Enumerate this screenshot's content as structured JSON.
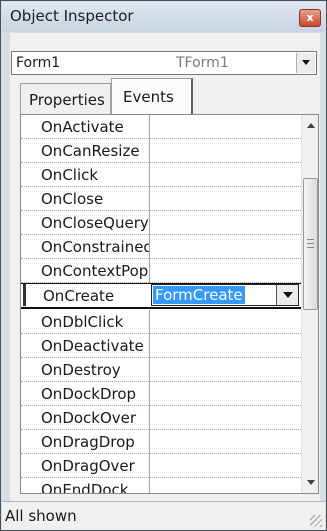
{
  "window": {
    "title": "Object Inspector",
    "close_glyph": "x"
  },
  "object_selector": {
    "name": "Form1",
    "class": "TForm1"
  },
  "tabs": [
    {
      "label": "Properties",
      "active": false
    },
    {
      "label": "Events",
      "active": true
    }
  ],
  "events": [
    {
      "name": "OnActivate",
      "value": ""
    },
    {
      "name": "OnCanResize",
      "value": ""
    },
    {
      "name": "OnClick",
      "value": ""
    },
    {
      "name": "OnClose",
      "value": ""
    },
    {
      "name": "OnCloseQuery",
      "value": ""
    },
    {
      "name": "OnConstrainedResize",
      "value": ""
    },
    {
      "name": "OnContextPopup",
      "value": ""
    },
    {
      "name": "OnCreate",
      "value": "FormCreate"
    },
    {
      "name": "OnDblClick",
      "value": ""
    },
    {
      "name": "OnDeactivate",
      "value": ""
    },
    {
      "name": "OnDestroy",
      "value": ""
    },
    {
      "name": "OnDockDrop",
      "value": ""
    },
    {
      "name": "OnDockOver",
      "value": ""
    },
    {
      "name": "OnDragDrop",
      "value": ""
    },
    {
      "name": "OnDragOver",
      "value": ""
    },
    {
      "name": "OnEndDock",
      "value": ""
    }
  ],
  "status": {
    "text": "All shown"
  },
  "icons": [
    "close-icon",
    "chevron-down-icon",
    "scroll-up-arrow-icon",
    "scroll-down-arrow-icon",
    "size-grip-icon"
  ],
  "colors": {
    "selection": "#3399ff",
    "title_bar": "#d3dce8"
  }
}
